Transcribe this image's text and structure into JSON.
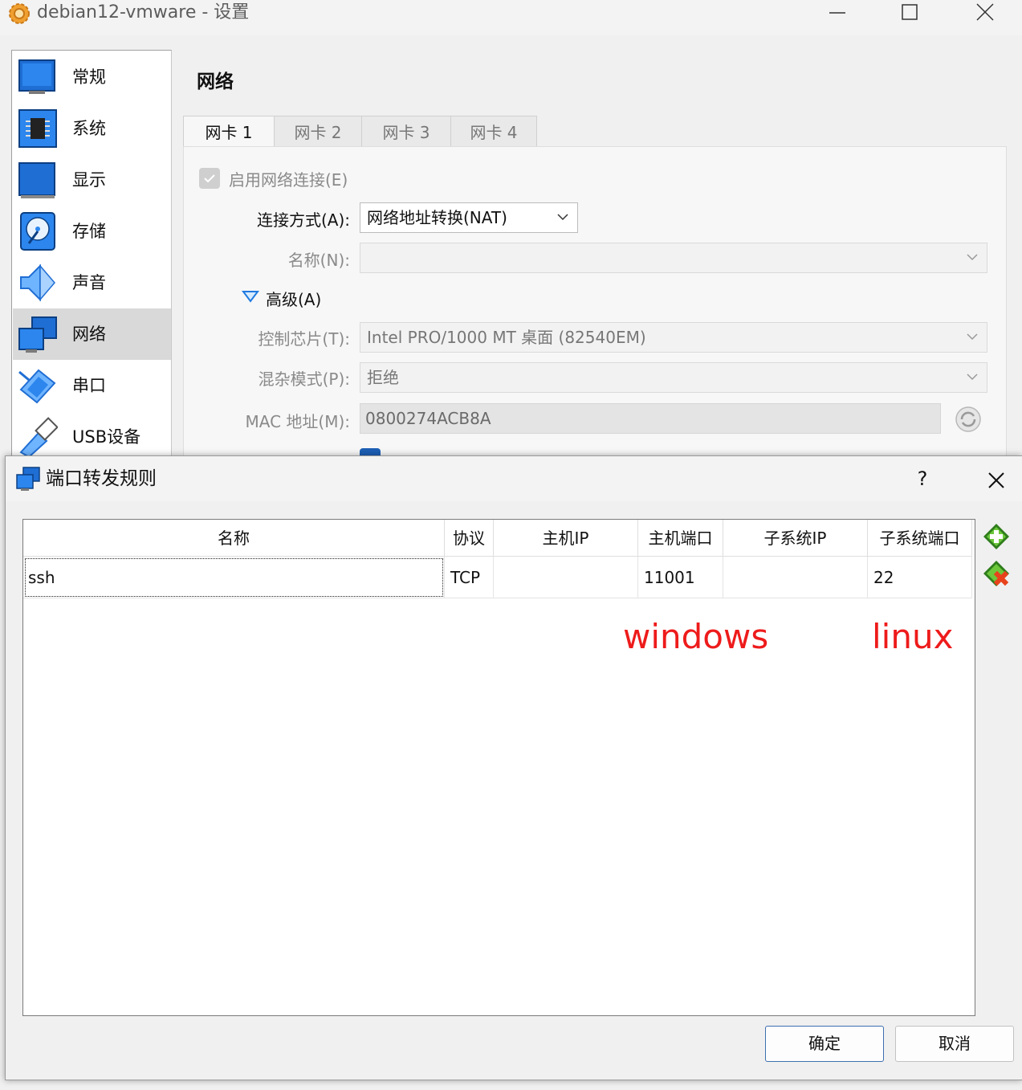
{
  "window": {
    "title": "debian12-vmware - 设置"
  },
  "sidebar": {
    "items": [
      {
        "label": "常规",
        "icon": "general-icon"
      },
      {
        "label": "系统",
        "icon": "system-chip-icon"
      },
      {
        "label": "显示",
        "icon": "display-icon"
      },
      {
        "label": "存储",
        "icon": "storage-disk-icon"
      },
      {
        "label": "声音",
        "icon": "speaker-icon"
      },
      {
        "label": "网络",
        "icon": "network-icon",
        "selected": true
      },
      {
        "label": "串口",
        "icon": "serial-port-icon"
      },
      {
        "label": "USB设备",
        "icon": "usb-icon"
      }
    ]
  },
  "network": {
    "title": "网络",
    "tabs": [
      "网卡 1",
      "网卡 2",
      "网卡 3",
      "网卡 4"
    ],
    "active_tab": 0,
    "enable_label": "启用网络连接(E)",
    "attach_label": "连接方式(A):",
    "attach_value": "网络地址转换(NAT)",
    "name_label": "名称(N):",
    "name_value": "",
    "advanced_label": "高级(A)",
    "adapter_label": "控制芯片(T):",
    "adapter_value": "Intel PRO/1000 MT 桌面 (82540EM)",
    "promisc_label": "混杂模式(P):",
    "promisc_value": "拒绝",
    "mac_label": "MAC 地址(M):",
    "mac_value": "0800274ACB8A"
  },
  "dialog": {
    "title": "端口转发规则",
    "help": "?",
    "columns": [
      "名称",
      "协议",
      "主机IP",
      "主机端口",
      "子系统IP",
      "子系统端口"
    ],
    "rows": [
      {
        "name": "ssh",
        "protocol": "TCP",
        "host_ip": "",
        "host_port": "11001",
        "guest_ip": "",
        "guest_port": "22"
      }
    ],
    "annotations": {
      "host": "windows",
      "guest": "linux",
      "color": "#ee1b1b"
    },
    "ok_label": "确定",
    "cancel_label": "取消"
  }
}
